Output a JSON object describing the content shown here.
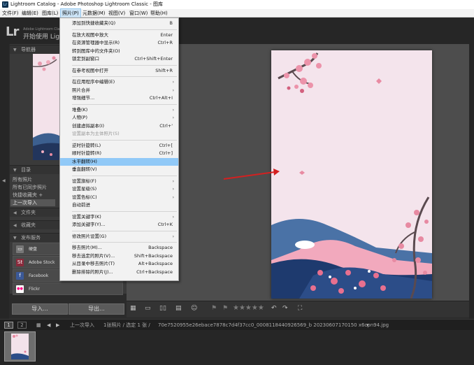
{
  "window": {
    "title": "Lightroom Catalog - Adobe Photoshop Lightroom Classic - 图库"
  },
  "menubar": [
    {
      "label": "文件(F)"
    },
    {
      "label": "编辑(E)"
    },
    {
      "label": "图库(L)"
    },
    {
      "label": "照片(P)"
    },
    {
      "label": "元数据(M)"
    },
    {
      "label": "视图(V)"
    },
    {
      "label": "窗口(W)"
    },
    {
      "label": "帮助(H)"
    }
  ],
  "identity": {
    "small": "Adobe Lightroom Classic",
    "main": "开始使用 Lightroom"
  },
  "left_panel": {
    "navigator": "导航器",
    "catalog": "目录",
    "catalog_items": [
      "所有照片",
      "所有已同步照片",
      "快捷收藏夹 +",
      "上一次导入"
    ],
    "folders": "文件夹",
    "collections": "收藏夹",
    "publish_services": "发布服务",
    "services": [
      {
        "label": "硬盘"
      },
      {
        "label": "Adobe Stock",
        "icon": "St"
      },
      {
        "label": "Facebook",
        "icon": "f"
      },
      {
        "label": "Flickr",
        "icon": "●●"
      }
    ],
    "import_btn": "导入...",
    "export_btn": "导出..."
  },
  "photo_menu": {
    "items": [
      {
        "label": "添加到快捷收藏夹(Q)",
        "shortcut": "B"
      },
      {
        "sep": true
      },
      {
        "label": "在放大视图中放大",
        "shortcut": "Enter"
      },
      {
        "label": "在资源管理器中显示(R)",
        "shortcut": "Ctrl+R"
      },
      {
        "label": "转到图库中的文件夹(O)"
      },
      {
        "label": "锁定到副窗口",
        "shortcut": "Ctrl+Shift+Enter"
      },
      {
        "sep": true
      },
      {
        "label": "在参考视图中打开",
        "shortcut": "Shift+R"
      },
      {
        "sep": true
      },
      {
        "label": "在应用程序中编辑(E)",
        "submenu": true
      },
      {
        "label": "照片合并",
        "submenu": true
      },
      {
        "label": "增强细节...",
        "shortcut": "Ctrl+Alt+I"
      },
      {
        "sep": true
      },
      {
        "label": "堆叠(K)",
        "submenu": true
      },
      {
        "label": "人物(P)",
        "submenu": true
      },
      {
        "label": "创建虚拟副本(I)",
        "shortcut": "Ctrl+'"
      },
      {
        "label": "设置副本为主体照片(S)",
        "disabled": true
      },
      {
        "sep": true
      },
      {
        "label": "逆时针旋转(L)",
        "shortcut": "Ctrl+["
      },
      {
        "label": "顺时针旋转(R)",
        "shortcut": "Ctrl+]"
      },
      {
        "label": "水平翻转(H)",
        "highlight": true
      },
      {
        "label": "垂直翻转(V)"
      },
      {
        "sep": true
      },
      {
        "label": "设置旗标(F)",
        "submenu": true
      },
      {
        "label": "设置星级(S)",
        "submenu": true
      },
      {
        "label": "设置色标(C)",
        "submenu": true
      },
      {
        "label": "自动前进"
      },
      {
        "sep": true
      },
      {
        "label": "设置关键字(K)",
        "submenu": true
      },
      {
        "label": "添加关键字(Y)...",
        "shortcut": "Ctrl+K"
      },
      {
        "sep": true
      },
      {
        "label": "修改照片设置(G)",
        "submenu": true
      },
      {
        "sep": true
      },
      {
        "label": "移去照片(M)...",
        "shortcut": "Backspace"
      },
      {
        "label": "移去选定的照片(V)...",
        "shortcut": "Shift+Backspace"
      },
      {
        "label": "从目录中移去照片(T)",
        "shortcut": "Alt+Backspace"
      },
      {
        "label": "删除排除的照片(J)...",
        "shortcut": "Ctrl+Backspace"
      }
    ]
  },
  "filmstrip": {
    "pages": [
      "1",
      "2"
    ],
    "source": "上一次导入",
    "count": "1张照片 / 选定 1 张 /",
    "filename": "70e7520955e26ebace7878c7d4f37cc0_0008118440926569_b 20230607170150 x6cpn94.jpg"
  },
  "toolbar": {
    "stars": "★★★★★"
  },
  "colors": {
    "highlight": "#91c9f7",
    "arrow": "#d42020",
    "bg": "#4d4d4d"
  }
}
